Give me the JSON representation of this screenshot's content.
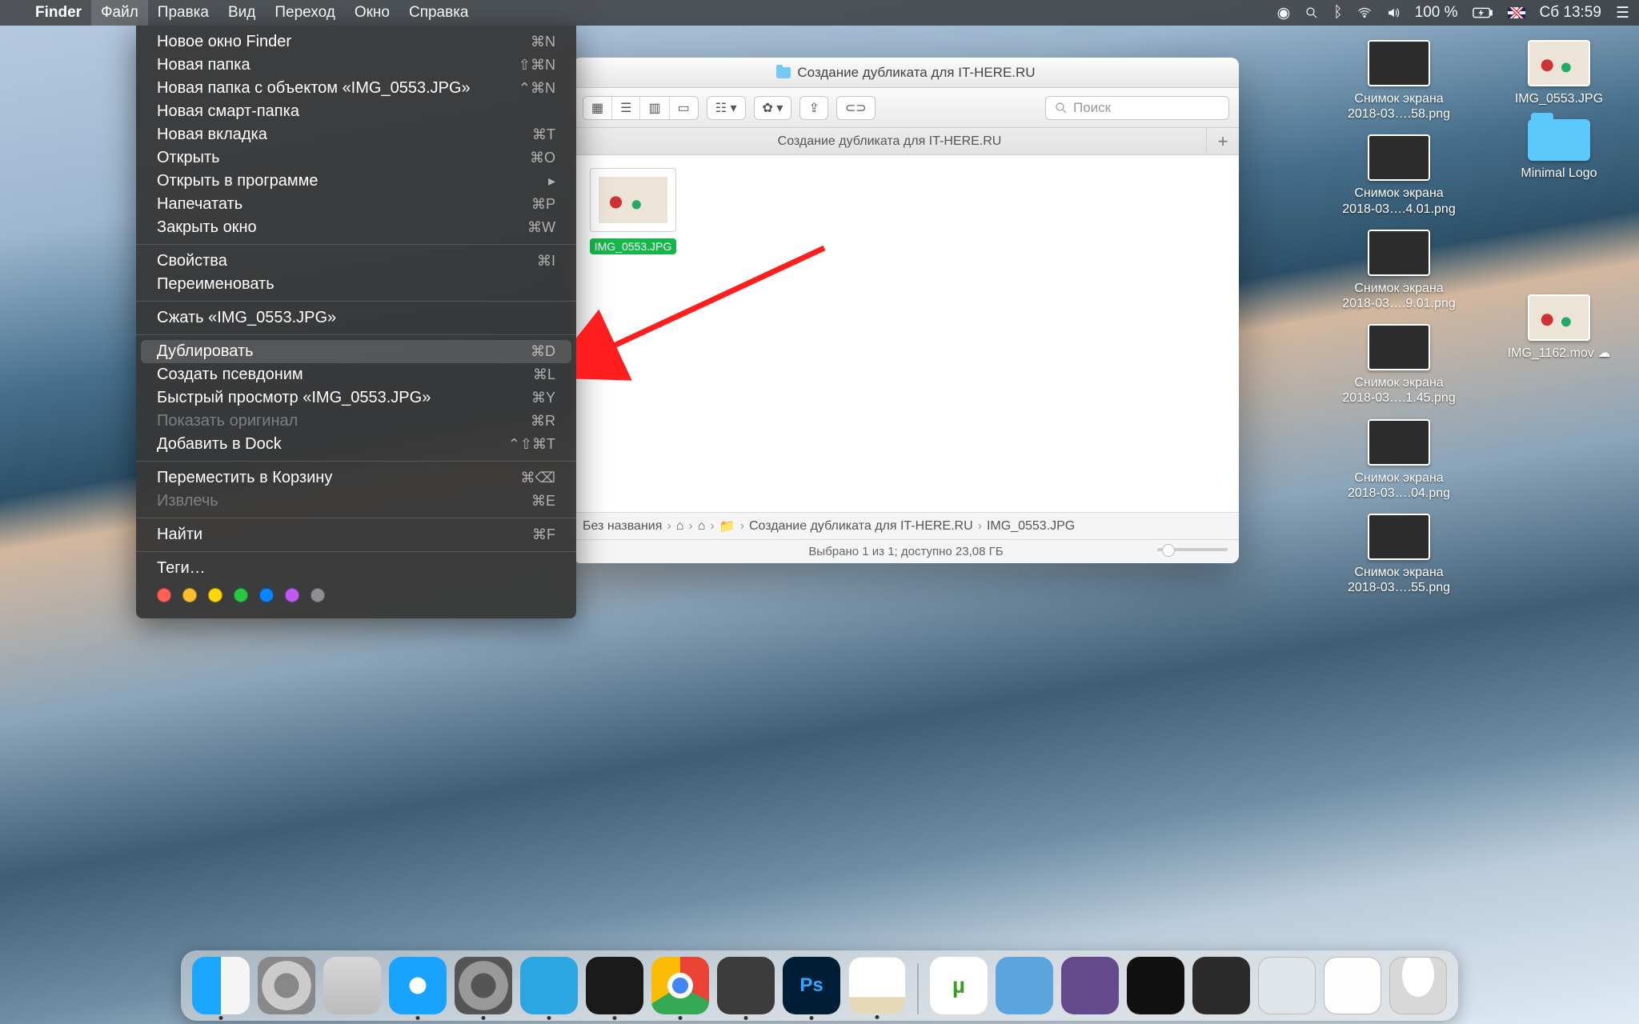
{
  "menubar": {
    "app": "Finder",
    "items": [
      "Файл",
      "Правка",
      "Вид",
      "Переход",
      "Окно",
      "Справка"
    ],
    "active_index": 0,
    "right": {
      "battery": "100 %",
      "lang": "GB",
      "clock": "Сб 13:59"
    }
  },
  "dropdown": {
    "groups": [
      [
        {
          "label": "Новое окно Finder",
          "shortcut": "⌘N"
        },
        {
          "label": "Новая папка",
          "shortcut": "⇧⌘N"
        },
        {
          "label": "Новая папка с объектом «IMG_0553.JPG»",
          "shortcut": "⌃⌘N"
        },
        {
          "label": "Новая смарт-папка",
          "shortcut": ""
        },
        {
          "label": "Новая вкладка",
          "shortcut": "⌘T"
        },
        {
          "label": "Открыть",
          "shortcut": "⌘O"
        },
        {
          "label": "Открыть в программе",
          "shortcut": "▸"
        },
        {
          "label": "Напечатать",
          "shortcut": "⌘P"
        },
        {
          "label": "Закрыть окно",
          "shortcut": "⌘W"
        }
      ],
      [
        {
          "label": "Свойства",
          "shortcut": "⌘I"
        },
        {
          "label": "Переименовать",
          "shortcut": ""
        }
      ],
      [
        {
          "label": "Сжать «IMG_0553.JPG»",
          "shortcut": ""
        }
      ],
      [
        {
          "label": "Дублировать",
          "shortcut": "⌘D",
          "highlight": true
        },
        {
          "label": "Создать псевдоним",
          "shortcut": "⌘L"
        },
        {
          "label": "Быстрый просмотр «IMG_0553.JPG»",
          "shortcut": "⌘Y"
        },
        {
          "label": "Показать оригинал",
          "shortcut": "⌘R",
          "disabled": true
        },
        {
          "label": "Добавить в Dock",
          "shortcut": "⌃⇧⌘T"
        }
      ],
      [
        {
          "label": "Переместить в Корзину",
          "shortcut": "⌘⌫"
        },
        {
          "label": "Извлечь",
          "shortcut": "⌘E",
          "disabled": true
        }
      ],
      [
        {
          "label": "Найти",
          "shortcut": "⌘F"
        }
      ],
      [
        {
          "label": "Теги…",
          "shortcut": ""
        }
      ]
    ],
    "tag_colors": [
      "#ff5f57",
      "#ffbd2e",
      "#ffd60a",
      "#28c840",
      "#0a84ff",
      "#bf5af2",
      "#8e8e93"
    ]
  },
  "finder": {
    "title": "Создание дубликата для IT-HERE.RU",
    "tab": "Создание дубликата для IT-HERE.RU",
    "search_placeholder": "Поиск",
    "file": "IMG_0553.JPG",
    "path": [
      "Без названия",
      "⌂",
      "⌂",
      "📁",
      "Создание дубликата для IT-HERE.RU",
      "IMG_0553.JPG"
    ],
    "status": "Выбрано 1 из 1; доступно 23,08 ГБ"
  },
  "desktop": {
    "col1": [
      {
        "label": "Снимок экрана 2018-03….58.png",
        "type": "dark"
      },
      {
        "label": "Снимок экрана 2018-03….4.01.png",
        "type": "dark"
      },
      {
        "label": "Снимок экрана 2018-03….9.01.png",
        "type": "dark"
      },
      {
        "label": "Снимок экрана 2018-03….1.45.png",
        "type": "dark"
      },
      {
        "label": "Снимок экрана 2018-03….04.png",
        "type": "dark"
      },
      {
        "label": "Снимок экрана 2018-03….55.png",
        "type": "dark"
      }
    ],
    "col2": [
      {
        "label": "IMG_0553.JPG",
        "type": "photo"
      },
      {
        "label": "Minimal Logo",
        "type": "folder"
      },
      {
        "label": "",
        "type": "spacer"
      },
      {
        "label": "IMG_1162.mov",
        "type": "photo",
        "cloud": true
      }
    ]
  },
  "dock": {
    "apps": [
      "finder",
      "launch",
      "tool",
      "safari",
      "pref",
      "telegram",
      "term",
      "chrome",
      "sublime",
      "ps",
      "notes"
    ],
    "right": [
      "ut",
      "expl",
      "ghost",
      "vid",
      "dock2",
      "winthumb",
      "winthumb2",
      "trash"
    ],
    "running": [
      0,
      3,
      4,
      5,
      6,
      7,
      8,
      9,
      10
    ]
  }
}
